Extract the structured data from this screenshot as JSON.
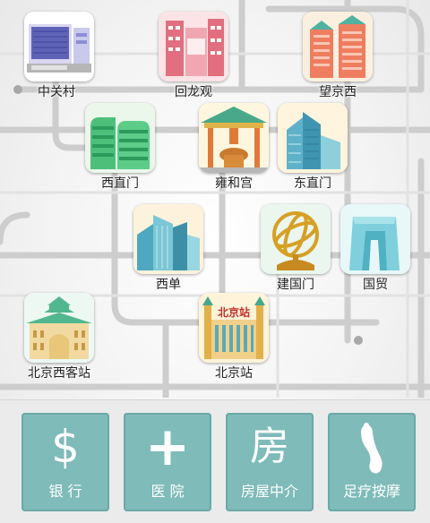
{
  "pois": [
    {
      "id": "zhongguancun",
      "label": "中关村",
      "icon": "computer-icon"
    },
    {
      "id": "huilongguan",
      "label": "回龙观",
      "icon": "residential-building-icon"
    },
    {
      "id": "wangjingxi",
      "label": "望京西",
      "icon": "apartment-towers-icon"
    },
    {
      "id": "xizhimen",
      "label": "西直门",
      "icon": "curved-building-icon"
    },
    {
      "id": "yonghegong",
      "label": "雍和宫",
      "icon": "temple-gate-icon"
    },
    {
      "id": "dongzhimen",
      "label": "东直门",
      "icon": "office-tower-icon"
    },
    {
      "id": "xidan",
      "label": "西单",
      "icon": "skyscrapers-icon"
    },
    {
      "id": "jianguomen",
      "label": "建国门",
      "icon": "armillary-sphere-icon"
    },
    {
      "id": "guomao",
      "label": "国贸",
      "icon": "cctv-tower-icon"
    },
    {
      "id": "beijingxikezhan",
      "label": "北京西客站",
      "icon": "west-railway-station-icon"
    },
    {
      "id": "beijingzhan",
      "label": "北京站",
      "icon": "railway-station-icon"
    }
  ],
  "station_sign_text": "北京站",
  "services": [
    {
      "id": "bank",
      "label": "银 行",
      "icon_glyph": "$",
      "icon": "dollar-icon"
    },
    {
      "id": "hospital",
      "label": "医 院",
      "icon_glyph": "+",
      "icon": "plus-icon"
    },
    {
      "id": "housing",
      "label": "房屋中介",
      "icon_glyph": "房",
      "icon": "house-character-icon"
    },
    {
      "id": "massage",
      "label": "足疗按摩",
      "icon_glyph": "",
      "icon": "foot-icon"
    }
  ],
  "colors": {
    "service_tile": "#7ebbb9",
    "map_road": "#d0d0d0"
  }
}
